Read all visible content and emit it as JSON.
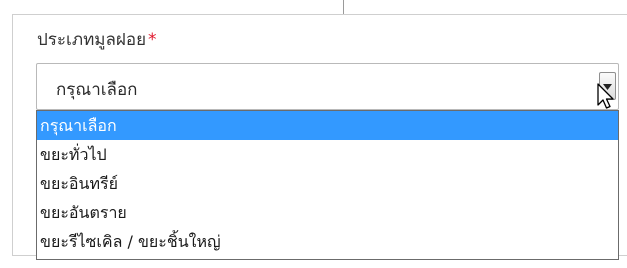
{
  "field": {
    "label": "ประเภทมูลฝอย",
    "required_mark": "*"
  },
  "select": {
    "value": "กรุณาเลือก",
    "options": [
      {
        "label": "กรุณาเลือก",
        "selected": true
      },
      {
        "label": "ขยะทั่วไป",
        "selected": false
      },
      {
        "label": "ขยะอินทรีย์",
        "selected": false
      },
      {
        "label": "ขยะอันตราย",
        "selected": false
      },
      {
        "label": "ขยะรีไซเคิล / ขยะชิ้นใหญ่",
        "selected": false
      }
    ]
  },
  "icons": {
    "dropdown_arrow": "chevron-down-icon",
    "pointer": "mouse-cursor-icon"
  },
  "colors": {
    "selected_bg": "#3399ff",
    "required": "#e0182d"
  }
}
